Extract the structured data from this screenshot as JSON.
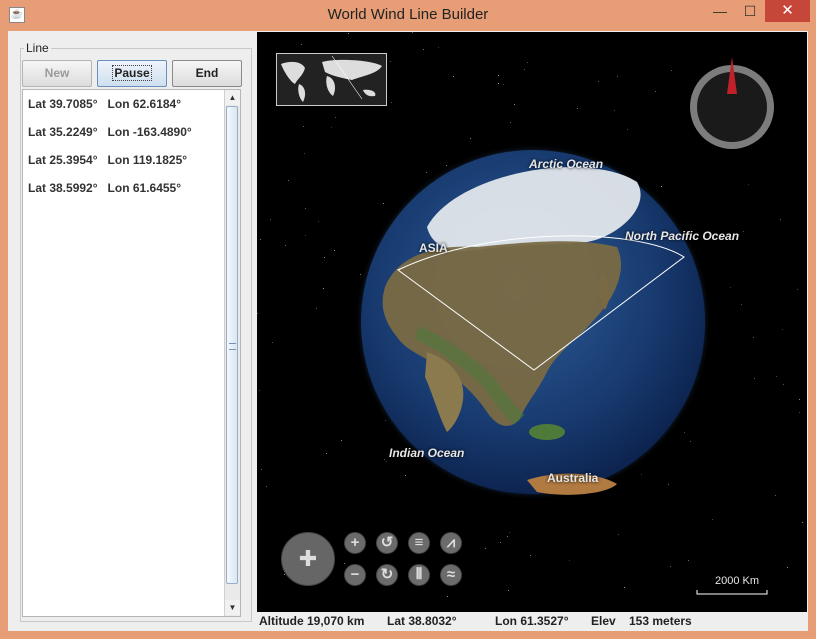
{
  "window": {
    "title": "World Wind Line Builder",
    "minimize_glyph": "—",
    "maximize_glyph": "☐",
    "close_glyph": "✕"
  },
  "panel": {
    "group_label": "Line",
    "buttons": {
      "new": "New",
      "pause": "Pause",
      "end": "End"
    },
    "positions": [
      {
        "lat": "Lat 39.7085°",
        "lon": "Lon 62.6184°"
      },
      {
        "lat": "Lat 35.2249°",
        "lon": "Lon -163.4890°"
      },
      {
        "lat": "Lat 25.3954°",
        "lon": "Lon 119.1825°"
      },
      {
        "lat": "Lat 38.5992°",
        "lon": "Lon 61.6455°"
      }
    ]
  },
  "globe": {
    "labels": {
      "arctic": "Arctic Ocean",
      "north_pacific": "North Pacific Ocean",
      "asia": "ASIA",
      "indian": "Indian Ocean",
      "australia": "Australia"
    },
    "scale": "2000 Km",
    "compass_color": "#C0202A"
  },
  "status": {
    "altitude_label": "Altitude",
    "altitude_value": "19,070 km",
    "lat": "Lat 38.8032°",
    "lon": "Lon 61.3527°",
    "elev_label": "Elev",
    "elev_value": "153 meters"
  }
}
